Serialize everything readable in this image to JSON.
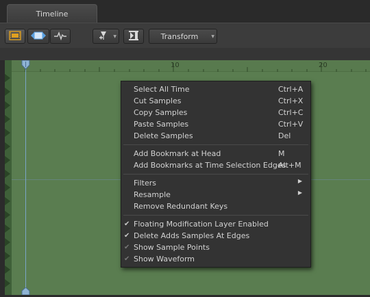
{
  "tab": {
    "title": "Timeline"
  },
  "toolbar": {
    "transform_label": "Transform"
  },
  "ruler": {
    "labels": [
      "10",
      "20"
    ]
  },
  "menu": {
    "items": [
      {
        "label": "Select All Time",
        "shortcut": "Ctrl+A"
      },
      {
        "label": "Cut Samples",
        "shortcut": "Ctrl+X"
      },
      {
        "label": "Copy Samples",
        "shortcut": "Ctrl+C"
      },
      {
        "label": "Paste Samples",
        "shortcut": "Ctrl+V"
      },
      {
        "label": "Delete Samples",
        "shortcut": "Del"
      },
      {
        "label": "Add Bookmark at Head",
        "shortcut": "M"
      },
      {
        "label": "Add Bookmarks at Time Selection Edges",
        "shortcut": "Alt+M"
      },
      {
        "label": "Filters",
        "shortcut": ""
      },
      {
        "label": "Resample",
        "shortcut": ""
      },
      {
        "label": "Remove Redundant Keys",
        "shortcut": ""
      },
      {
        "label": "Floating Modification Layer Enabled",
        "checked": true
      },
      {
        "label": "Delete Adds Samples At Edges",
        "checked": true
      },
      {
        "label": "Show Sample Points",
        "checked": true
      },
      {
        "label": "Show Waveform",
        "checked": true
      }
    ]
  },
  "colors": {
    "track": "#5a7d50",
    "menu": "#333333",
    "accent": "#e0a020"
  }
}
